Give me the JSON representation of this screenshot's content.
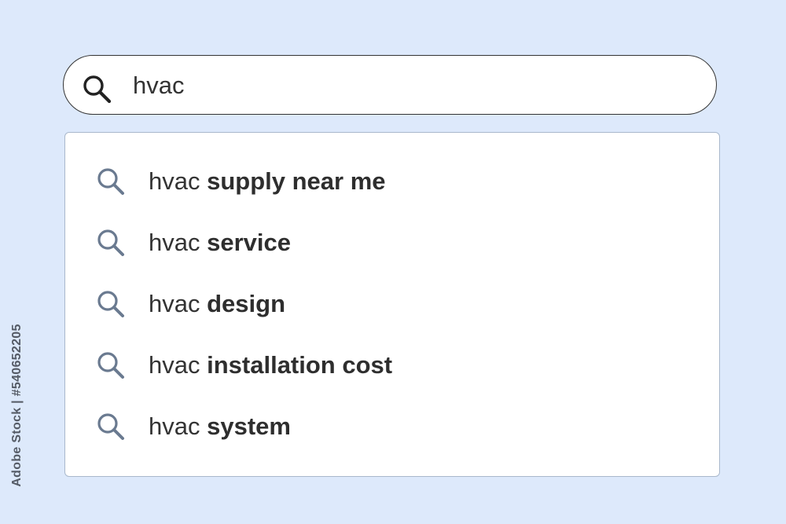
{
  "search": {
    "value": "hvac",
    "icon": "search-icon"
  },
  "suggestions": [
    {
      "prefix": "hvac ",
      "completion": "supply near me",
      "icon": "search-icon"
    },
    {
      "prefix": "hvac ",
      "completion": "service",
      "icon": "search-icon"
    },
    {
      "prefix": "hvac ",
      "completion": "design",
      "icon": "search-icon"
    },
    {
      "prefix": "hvac ",
      "completion": "installation cost",
      "icon": "search-icon"
    },
    {
      "prefix": "hvac ",
      "completion": "system",
      "icon": "search-icon"
    }
  ],
  "watermark": {
    "text": "Adobe Stock | #540652205"
  },
  "colors": {
    "background": "#dde9fb",
    "search_icon_main": "#222222",
    "suggestion_icon": "#6a7a90",
    "text": "#333333"
  }
}
